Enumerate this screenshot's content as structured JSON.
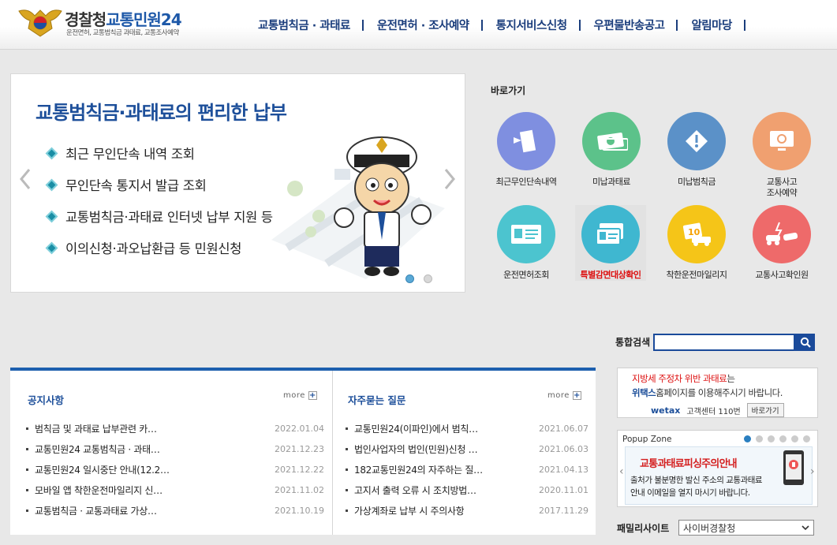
{
  "header": {
    "logo_title_part1": "경찰청",
    "logo_title_part2": "교통민원24",
    "logo_subtitle": "운전면허, 교통범칙금 과태료, 교통조사예약",
    "nav": [
      "교통범칙금 · 과태료",
      "운전면허 · 조사예약",
      "통지서비스신청",
      "우편물반송공고",
      "알림마당"
    ]
  },
  "slider": {
    "headline": "교통범칙금·과태료의 편리한 납부",
    "items": [
      "최근 무인단속 내역 조회",
      "무인단속 통지서 발급 조회",
      "교통범칙금·과태료 인터넷 납부 지원 등",
      "이의신청·과오납환급 등 민원신청"
    ],
    "current_slide": 1,
    "total_slides": 2
  },
  "quick": {
    "title": "바로가기",
    "items": [
      {
        "label1": "최근무인단속내역",
        "label2": "",
        "icon": "camera-icon",
        "color": "#7f8fe0"
      },
      {
        "label1": "미납과태료",
        "label2": "",
        "icon": "money-icon",
        "color": "#5cc28a"
      },
      {
        "label1": "미납범칙금",
        "label2": "",
        "icon": "warning-icon",
        "color": "#5b91c8"
      },
      {
        "label1": "교통사고",
        "label2": "조사예약",
        "icon": "monitor-icon",
        "color": "#f0a070"
      },
      {
        "label1": "운전면허조회",
        "label2": "",
        "icon": "license-card-icon",
        "color": "#4cc4cf"
      },
      {
        "label1": "특별감면대상확인",
        "label2": "",
        "icon": "id-card-icon",
        "color": "#3fb7d0"
      },
      {
        "label1": "착한운전마일리지",
        "label2": "",
        "icon": "mileage-icon",
        "color": "#f5c518"
      },
      {
        "label1": "교통사고확인원",
        "label2": "",
        "icon": "car-crash-icon",
        "color": "#ee6a6a"
      }
    ]
  },
  "search": {
    "label": "통합검색",
    "value": ""
  },
  "notice": {
    "title": "공지사항",
    "more": "more",
    "items": [
      {
        "title": "범칙금 및 과태료 납부관련 카…",
        "date": "2022.01.04"
      },
      {
        "title": "교통민원24 교통범칙금 · 과태…",
        "date": "2021.12.23"
      },
      {
        "title": "교통민원24 일시중단 안내(12.2…",
        "date": "2021.12.22"
      },
      {
        "title": "모바일 앱 착한운전마일리지 신…",
        "date": "2021.11.02"
      },
      {
        "title": "교통범칙금 · 교통과태료 가상…",
        "date": "2021.10.19"
      }
    ]
  },
  "faq": {
    "title": "자주묻는 질문",
    "more": "more",
    "items": [
      {
        "title": "교통민원24(이파인)에서 범칙…",
        "date": "2021.06.07"
      },
      {
        "title": "법인사업자의 법인(민원)신청 …",
        "date": "2021.06.03"
      },
      {
        "title": "182교통민원24의 자주하는 질…",
        "date": "2021.04.13"
      },
      {
        "title": "고지서 출력 오류 시 조치방법…",
        "date": "2020.11.01"
      },
      {
        "title": "가상계좌로 납부 시 주의사항",
        "date": "2017.11.29"
      }
    ]
  },
  "wetax": {
    "line1_red": "지방세 주정차 위반 과태료",
    "line1_rest": "는",
    "line2_blue": "위택스",
    "line2_rest": "홈페이지를 이용해주시기 바랍니다.",
    "brand": "wetax",
    "center": "고객센터 110번",
    "button": "바로가기"
  },
  "popup": {
    "title": "Popup Zone",
    "current": 1,
    "total": 6,
    "heading": "교통과태료피싱주의안내",
    "body1": "출처가 불분명한 발신 주소의 교통과태료",
    "body2": "안내 이메일을 열지 마시기 바랍니다."
  },
  "family": {
    "label": "패밀리사이트",
    "selected": "사이버경찰청"
  }
}
